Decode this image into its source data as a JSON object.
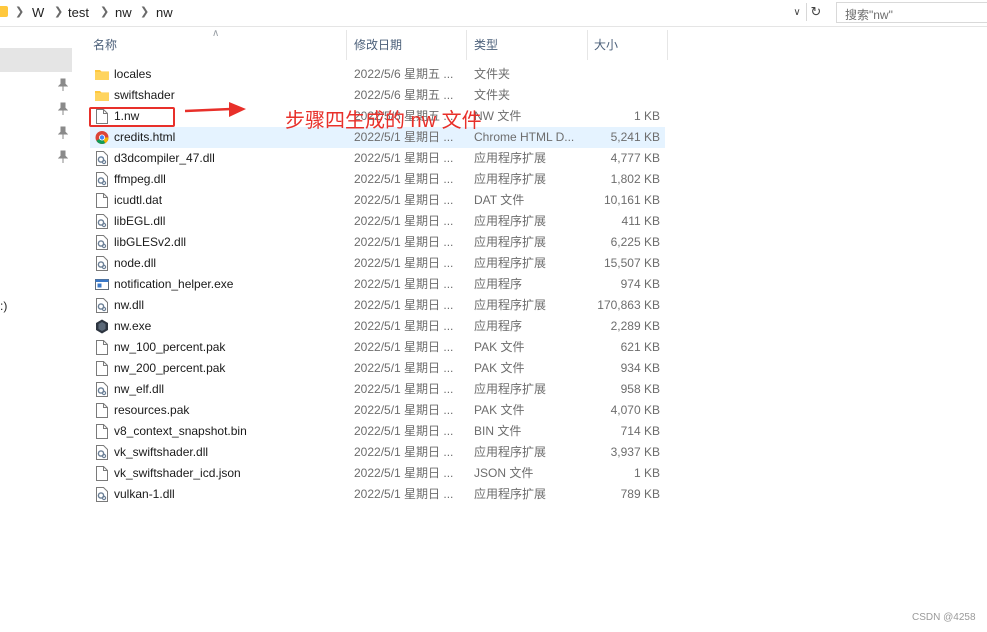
{
  "address_bar": {
    "crumbs": [
      "W",
      "test",
      "nw",
      "nw"
    ],
    "search_placeholder": "搜索\"nw\""
  },
  "nav_pane": {
    "fragment_label": ":)"
  },
  "columns": {
    "name": "名称",
    "date": "修改日期",
    "type": "类型",
    "size": "大小"
  },
  "files": [
    {
      "name": "locales",
      "date": "2022/5/6 星期五 ...",
      "type": "文件夹",
      "size": "",
      "icon": "folder-icon"
    },
    {
      "name": "swiftshader",
      "date": "2022/5/6 星期五 ...",
      "type": "文件夹",
      "size": "",
      "icon": "folder-icon"
    },
    {
      "name": "1.nw",
      "date": "2022/5/6 星期五 ...",
      "type": "NW 文件",
      "size": "1 KB",
      "icon": "file-icon"
    },
    {
      "name": "credits.html",
      "date": "2022/5/1 星期日 ...",
      "type": "Chrome HTML D...",
      "size": "5,241 KB",
      "icon": "chrome-icon"
    },
    {
      "name": "d3dcompiler_47.dll",
      "date": "2022/5/1 星期日 ...",
      "type": "应用程序扩展",
      "size": "4,777 KB",
      "icon": "dll-icon"
    },
    {
      "name": "ffmpeg.dll",
      "date": "2022/5/1 星期日 ...",
      "type": "应用程序扩展",
      "size": "1,802 KB",
      "icon": "dll-icon"
    },
    {
      "name": "icudtl.dat",
      "date": "2022/5/1 星期日 ...",
      "type": "DAT 文件",
      "size": "10,161 KB",
      "icon": "file-icon"
    },
    {
      "name": "libEGL.dll",
      "date": "2022/5/1 星期日 ...",
      "type": "应用程序扩展",
      "size": "411 KB",
      "icon": "dll-icon"
    },
    {
      "name": "libGLESv2.dll",
      "date": "2022/5/1 星期日 ...",
      "type": "应用程序扩展",
      "size": "6,225 KB",
      "icon": "dll-icon"
    },
    {
      "name": "node.dll",
      "date": "2022/5/1 星期日 ...",
      "type": "应用程序扩展",
      "size": "15,507 KB",
      "icon": "dll-icon"
    },
    {
      "name": "notification_helper.exe",
      "date": "2022/5/1 星期日 ...",
      "type": "应用程序",
      "size": "974 KB",
      "icon": "exe-window-icon"
    },
    {
      "name": "nw.dll",
      "date": "2022/5/1 星期日 ...",
      "type": "应用程序扩展",
      "size": "170,863 KB",
      "icon": "dll-icon"
    },
    {
      "name": "nw.exe",
      "date": "2022/5/1 星期日 ...",
      "type": "应用程序",
      "size": "2,289 KB",
      "icon": "nw-exe-icon"
    },
    {
      "name": "nw_100_percent.pak",
      "date": "2022/5/1 星期日 ...",
      "type": "PAK 文件",
      "size": "621 KB",
      "icon": "file-icon"
    },
    {
      "name": "nw_200_percent.pak",
      "date": "2022/5/1 星期日 ...",
      "type": "PAK 文件",
      "size": "934 KB",
      "icon": "file-icon"
    },
    {
      "name": "nw_elf.dll",
      "date": "2022/5/1 星期日 ...",
      "type": "应用程序扩展",
      "size": "958 KB",
      "icon": "dll-icon"
    },
    {
      "name": "resources.pak",
      "date": "2022/5/1 星期日 ...",
      "type": "PAK 文件",
      "size": "4,070 KB",
      "icon": "file-icon"
    },
    {
      "name": "v8_context_snapshot.bin",
      "date": "2022/5/1 星期日 ...",
      "type": "BIN 文件",
      "size": "714 KB",
      "icon": "file-icon"
    },
    {
      "name": "vk_swiftshader.dll",
      "date": "2022/5/1 星期日 ...",
      "type": "应用程序扩展",
      "size": "3,937 KB",
      "icon": "dll-icon"
    },
    {
      "name": "vk_swiftshader_icd.json",
      "date": "2022/5/1 星期日 ...",
      "type": "JSON 文件",
      "size": "1 KB",
      "icon": "file-icon"
    },
    {
      "name": "vulkan-1.dll",
      "date": "2022/5/1 星期日 ...",
      "type": "应用程序扩展",
      "size": "789 KB",
      "icon": "dll-icon"
    }
  ],
  "highlighted_row": 3,
  "annotation": {
    "text": "步骤四生成的 nw 文件",
    "color": "#e8302a"
  },
  "watermark": "CSDN @4258"
}
